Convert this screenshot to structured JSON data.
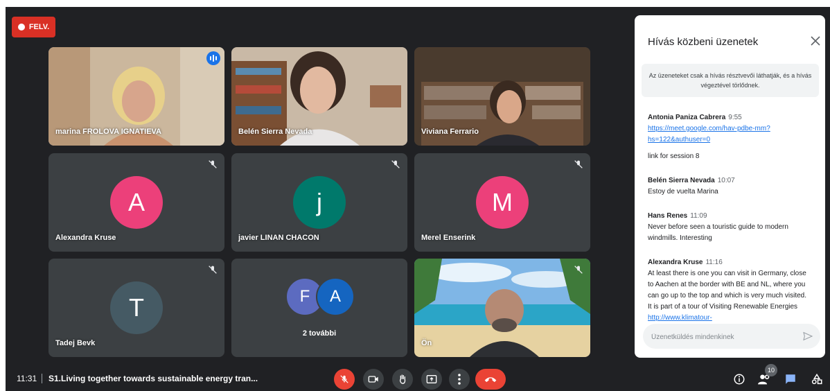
{
  "recording": {
    "label": "FELV."
  },
  "participants": [
    {
      "name": "marina FROLOVA IGNATIEVA",
      "kind": "video"
    },
    {
      "name": "Belén Sierra Nevada",
      "kind": "video"
    },
    {
      "name": "Viviana Ferrario",
      "kind": "video"
    },
    {
      "name": "Alexandra Kruse",
      "kind": "avatar",
      "initial": "A",
      "color": "#ec407a"
    },
    {
      "name": "javier LINAN CHACON",
      "kind": "avatar",
      "initial": "j",
      "color": "#00796b"
    },
    {
      "name": "Merel Enserink",
      "kind": "avatar",
      "initial": "M",
      "color": "#ec407a"
    },
    {
      "name": "Tadej Bevk",
      "kind": "avatar",
      "initial": "T",
      "color": "#455a64"
    },
    {
      "name": "2 további",
      "kind": "group",
      "initials": [
        "F",
        "A"
      ],
      "colors": [
        "#5c6bc0",
        "#1565c0"
      ]
    },
    {
      "name": "Ön",
      "kind": "video"
    }
  ],
  "chat": {
    "title": "Hívás közbeni üzenetek",
    "notice": "Az üzeneteket csak a hívás résztvevői láthatják, és a hívás végeztével törlődnek.",
    "messages": [
      {
        "sender": "Antonia Paniza Cabrera",
        "time": "9:55",
        "link": "https://meet.google.com/hav-pdbe-mm?hs=122&authuser=0",
        "text": "link for session 8"
      },
      {
        "sender": "Belén Sierra Nevada",
        "time": "10:07",
        "link": "",
        "text": "Estoy de vuelta Marina"
      },
      {
        "sender": "Hans Renes",
        "time": "11:09",
        "link": "",
        "text": "Never before seen a touristic guide to modern windmills. Interesting"
      },
      {
        "sender": "Alexandra Kruse",
        "time": "11:16",
        "link": "",
        "text": "At least there is one you can visit in Germany, close to Aachen at the border with BE and NL, where you can go up to the top and which is very much visited. It is part of a tour of Visiting Renewable Energies",
        "link_after": "http://www.klimatour-"
      }
    ],
    "input_placeholder": "Üzenetküldés mindenkinek"
  },
  "bottom_bar": {
    "time": "11:31",
    "meeting_title": "S1.Living together towards sustainable energy tran...",
    "people_count": "10"
  },
  "icons": {
    "mute": "mic-off-icon",
    "camera": "camera-icon",
    "hand": "raise-hand-icon",
    "present": "present-screen-icon",
    "more": "more-options-icon",
    "leave": "leave-call-icon",
    "info": "info-icon",
    "people": "people-icon",
    "chat": "chat-icon",
    "activities": "activities-icon"
  },
  "colors": {
    "background": "#202124",
    "tile": "#3c4043",
    "danger": "#ea4335",
    "accent": "#1a73e8",
    "active_border": "#8ab4f8"
  }
}
